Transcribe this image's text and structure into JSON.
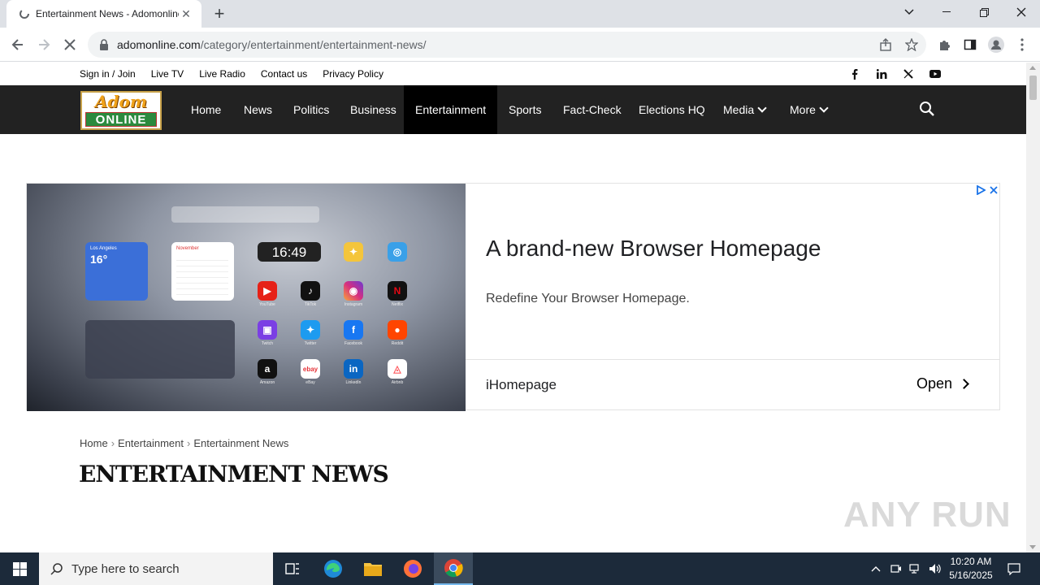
{
  "browser": {
    "tab_title": "Entertainment News - Adomonline",
    "url_domain": "adomonline.com",
    "url_path": "/category/entertainment/entertainment-news/"
  },
  "site": {
    "top_links": [
      "Sign in / Join",
      "Live TV",
      "Live Radio",
      "Contact us",
      "Privacy Policy"
    ],
    "logo_top": "Adom",
    "logo_bottom": "ONLINE",
    "nav": {
      "home": "Home",
      "news": "News",
      "politics": "Politics",
      "business": "Business",
      "entertainment": "Entertainment",
      "sports": "Sports",
      "factcheck": "Fact-Check",
      "elections": "Elections HQ",
      "media": "Media",
      "more": "More"
    }
  },
  "ad": {
    "title": "A brand-new Browser Homepage",
    "subtitle": "Redefine Your Browser Homepage.",
    "brand": "iHomepage",
    "cta": "Open",
    "widget_city": "Los Angeles",
    "widget_temp": "16°",
    "widget_month": "November",
    "widget_clock": "16:49",
    "apps": [
      "YouTube",
      "TikTok",
      "Instagram",
      "Netflix",
      "Twitch",
      "Twitter",
      "Facebook",
      "Reddit",
      "Amazon",
      "eBay",
      "LinkedIn",
      "Airbnb"
    ]
  },
  "breadcrumb": [
    "Home",
    "Entertainment",
    "Entertainment News"
  ],
  "page_title": "ENTERTAINMENT NEWS",
  "watermark": "ANY RUN",
  "taskbar": {
    "search_placeholder": "Type here to search",
    "time": "10:20 AM",
    "date": "5/16/2025"
  },
  "colors": {
    "nav_bg": "#222222",
    "nav_active": "#000000",
    "taskbar": "#1c2a3a"
  }
}
